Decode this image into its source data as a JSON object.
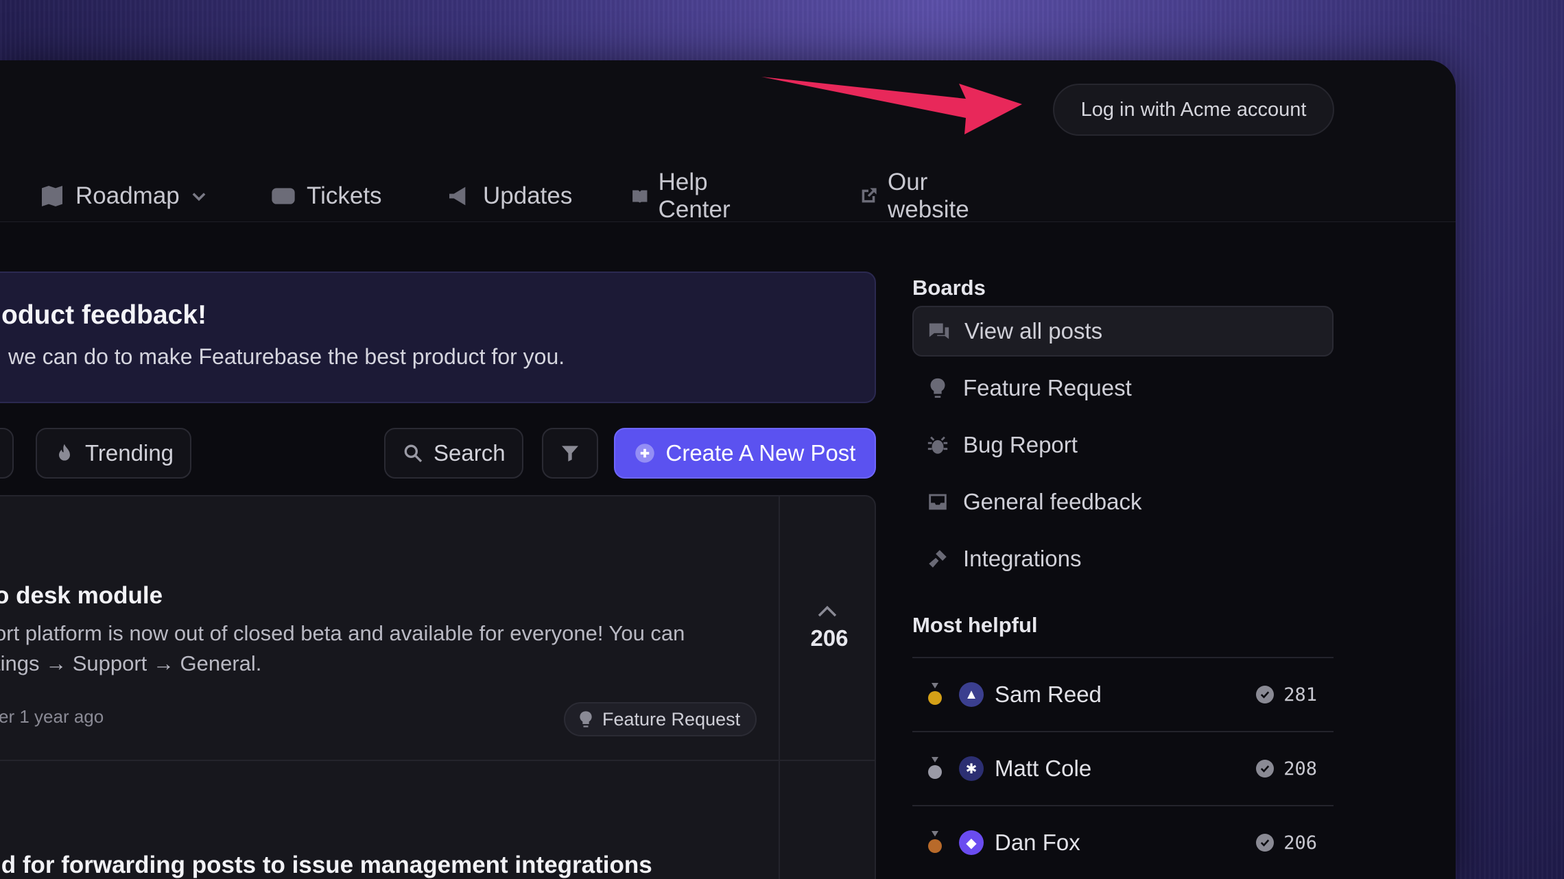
{
  "header": {
    "login_label": "Log in with Acme account"
  },
  "nav": {
    "items": [
      {
        "label": "Roadmap",
        "icon": "map-icon"
      },
      {
        "label": "Tickets",
        "icon": "ticket-icon"
      },
      {
        "label": "Updates",
        "icon": "megaphone-icon"
      },
      {
        "label": "Help Center",
        "icon": "book-icon"
      },
      {
        "label": "Our website",
        "icon": "external-link-icon"
      }
    ]
  },
  "banner": {
    "title": "oduct feedback!",
    "description": " we can do to make Featurebase the best product for you."
  },
  "toolbar": {
    "trending_label": "Trending",
    "search_label": "Search",
    "create_label": "Create A New Post"
  },
  "posts": [
    {
      "title": "o desk module",
      "body_line1": "ort platform is now out of closed beta and available for everyone! You can",
      "body_line2": "tings → Support → General.",
      "meta": "er 1 year ago",
      "tag": "Feature Request",
      "votes": "206"
    },
    {
      "title": "ld for forwarding posts to issue management integrations"
    }
  ],
  "sidebar": {
    "boards_heading": "Boards",
    "boards": [
      {
        "label": "View all posts",
        "icon": "chat-icon"
      },
      {
        "label": "Feature Request",
        "icon": "lightbulb-icon"
      },
      {
        "label": "Bug Report",
        "icon": "bug-icon"
      },
      {
        "label": "General feedback",
        "icon": "inbox-icon"
      },
      {
        "label": "Integrations",
        "icon": "plug-icon"
      }
    ],
    "helpful_heading": "Most helpful",
    "helpful": [
      {
        "name": "Sam Reed",
        "score": "281",
        "medal_color": "#d4a017",
        "avatar_color": "#3b3f8f"
      },
      {
        "name": "Matt Cole",
        "score": "208",
        "medal_color": "#9a9aa6",
        "avatar_color": "#2c2f72"
      },
      {
        "name": "Dan Fox",
        "score": "206",
        "medal_color": "#b86a2a",
        "avatar_color": "#6a4cf0"
      }
    ]
  },
  "colors": {
    "accent": "#5b52f0",
    "arrow": "#e8285a"
  }
}
